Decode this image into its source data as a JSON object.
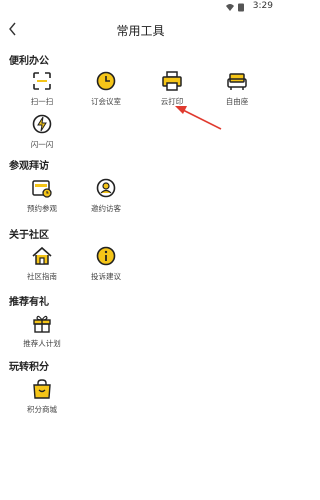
{
  "status_bar": {
    "time": "3:29"
  },
  "header": {
    "title": "常用工具"
  },
  "sections": [
    {
      "title": "便利办公",
      "items": [
        {
          "label": "扫一扫",
          "icon": "scan-icon"
        },
        {
          "label": "订会议室",
          "icon": "clock-icon"
        },
        {
          "label": "云打印",
          "icon": "printer-icon"
        },
        {
          "label": "自由座",
          "icon": "sofa-icon"
        },
        {
          "label": "闪一闪",
          "icon": "flash-icon"
        }
      ]
    },
    {
      "title": "参观拜访",
      "items": [
        {
          "label": "预约参观",
          "icon": "calendar-card-icon"
        },
        {
          "label": "邀约访客",
          "icon": "visitor-icon"
        }
      ]
    },
    {
      "title": "关于社区",
      "items": [
        {
          "label": "社区指南",
          "icon": "home-icon"
        },
        {
          "label": "投诉建议",
          "icon": "info-icon"
        }
      ]
    },
    {
      "title": "推荐有礼",
      "items": [
        {
          "label": "推荐人计划",
          "icon": "gift-icon"
        }
      ]
    },
    {
      "title": "玩转积分",
      "items": [
        {
          "label": "积分商城",
          "icon": "shopping-bag-icon"
        }
      ]
    }
  ],
  "colors": {
    "icon_primary": "#222222",
    "icon_accent": "#F5C518",
    "arrow": "#E03A2F"
  }
}
